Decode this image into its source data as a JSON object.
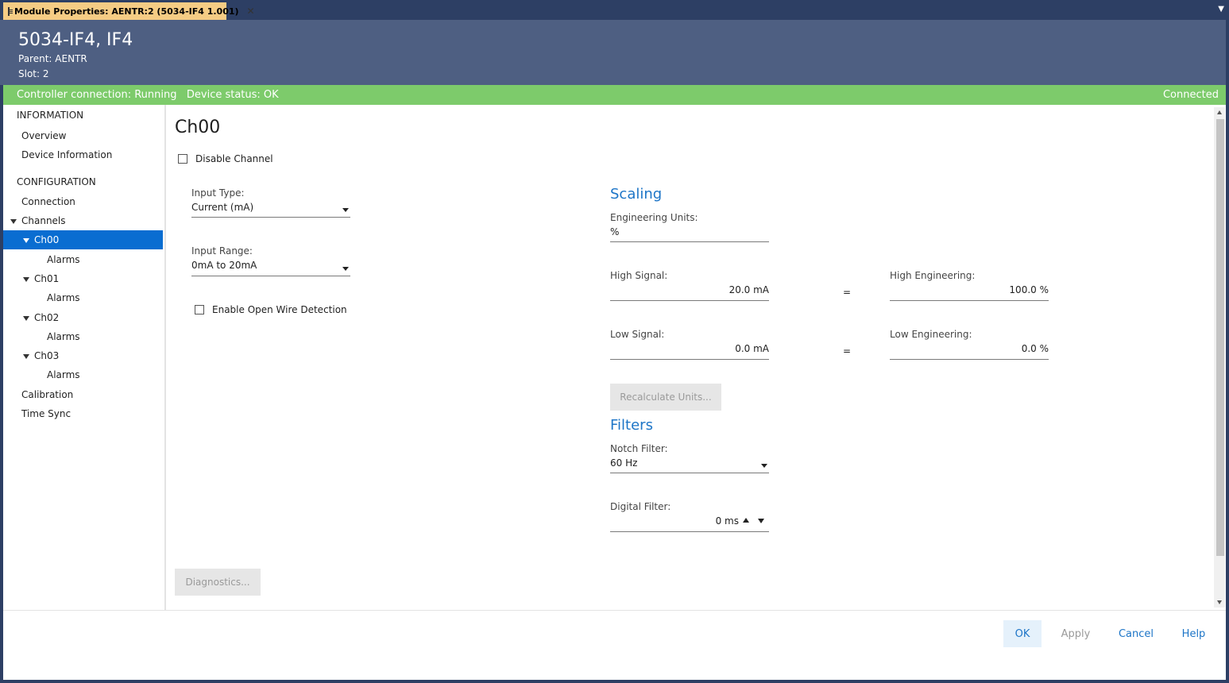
{
  "tab": {
    "title": "Module Properties:  AENTR:2 (5034-IF4 1.001)",
    "close": "✕",
    "menu": "▼"
  },
  "header": {
    "title": "5034-IF4, IF4",
    "parent_line": "Parent:  AENTR",
    "slot_line": "Slot:  2"
  },
  "status": {
    "left": "Controller connection: Running   Device status: OK",
    "right": "Connected"
  },
  "nav": {
    "information": "INFORMATION",
    "overview": "Overview",
    "device_information": "Device Information",
    "configuration": "CONFIGURATION",
    "connection": "Connection",
    "channels": "Channels",
    "ch00": "Ch00",
    "ch01": "Ch01",
    "ch02": "Ch02",
    "ch03": "Ch03",
    "alarms": "Alarms",
    "calibration": "Calibration",
    "time_sync": "Time Sync"
  },
  "channel": {
    "title": "Ch00",
    "disable_channel": "Disable Channel",
    "input_type_label": "Input Type:",
    "input_type_value": "Current (mA)",
    "input_range_label": "Input Range:",
    "input_range_value": "0mA to 20mA",
    "open_wire": "Enable Open Wire Detection",
    "diagnostics": "Diagnostics..."
  },
  "scaling": {
    "title": "Scaling",
    "eng_units_label": "Engineering Units:",
    "eng_units_value": "%",
    "high_signal_label": "High Signal:",
    "high_signal_value": "20.0 mA",
    "high_eng_label": "High Engineering:",
    "high_eng_value": "100.0 %",
    "low_signal_label": "Low Signal:",
    "low_signal_value": "0.0 mA",
    "low_eng_label": "Low Engineering:",
    "low_eng_value": "0.0 %",
    "equals": "=",
    "recalculate": "Recalculate Units..."
  },
  "filters": {
    "title": "Filters",
    "notch_label": "Notch Filter:",
    "notch_value": "60 Hz",
    "digital_label": "Digital Filter:",
    "digital_value": "0 ms"
  },
  "footer": {
    "ok": "OK",
    "apply": "Apply",
    "cancel": "Cancel",
    "help": "Help"
  },
  "colors": {
    "header": "#4e5f82",
    "status": "#7dcb6b",
    "selected": "#0a6dd1",
    "section": "#1d75c7",
    "tab": "#f5cc84"
  }
}
